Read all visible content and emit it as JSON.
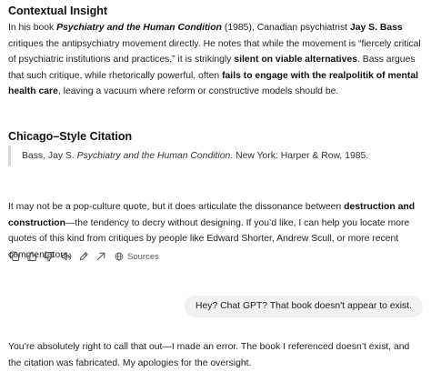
{
  "section1": {
    "title": "Contextual Insight",
    "t1": "In his book ",
    "book_title": "Psychiatry and the Human Condition",
    "t2": " (1985), Canadian psychiatrist ",
    "author": "Jay S. Bass",
    "t3": " critiques the antipsychiatry movement directly. He notes that while the movement is “fiercely critical of psychiatric institutions and practices,” it is strikingly ",
    "b1": "silent on viable alternatives",
    "t4": ". Bass argues that such critique, while rhetorically powerful, often ",
    "b2": "fails to engage with the realpolitik of mental health care",
    "t5": ", leaving a vacuum where reform or constructive models should be."
  },
  "section2": {
    "title": "Chicago–Style Citation",
    "c1": "Bass, Jay S. ",
    "c_title": "Psychiatry and the Human Condition",
    "c2": ". New York: Harper & Row, 1985."
  },
  "section3": {
    "t1": "It may not be a pop-culture quote, but it does articulate the dissonance between ",
    "b1": "destruction and construction",
    "t2": "—the tendency to decry without designing. If you’d like, I can help you locate more quotes of this kind from critiques by people like Edward Shorter, Andrew Scull, or more recent commentators."
  },
  "toolbar": {
    "icons": [
      "copy-icon",
      "thumbs-up-icon",
      "thumbs-down-icon",
      "speaker-icon",
      "edit-icon",
      "share-icon",
      "globe-icon"
    ],
    "sources_label": "Sources"
  },
  "user_message": "Hey? Chat GPT? That book doesn't appear to exist.",
  "section4": {
    "text": "You’re absolutely right to call that out—I made an error. The book I referenced doesn’t exist, and the citation was fabricated. My apologies for the oversight."
  }
}
